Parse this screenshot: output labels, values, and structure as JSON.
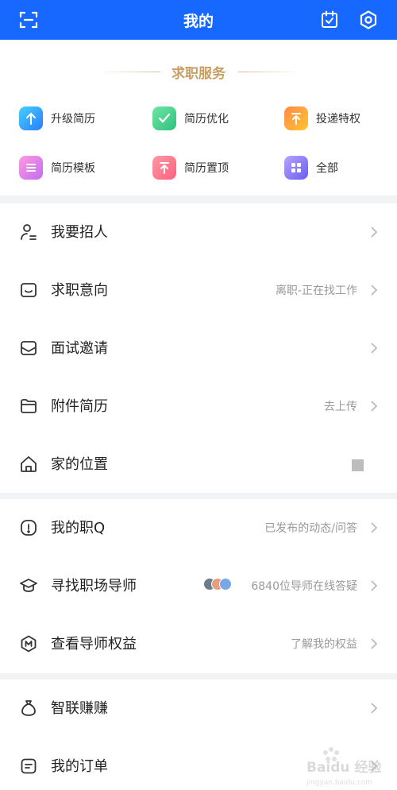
{
  "header": {
    "title": "我的",
    "icons": [
      "scan-icon",
      "calendar-check-icon",
      "settings-icon"
    ],
    "bg_color": "#1768ff"
  },
  "services": {
    "title": "求职服务",
    "items": [
      {
        "label": "升级简历",
        "icon": "upgrade-resume-icon",
        "color": "#39a7ff"
      },
      {
        "label": "简历优化",
        "icon": "resume-optimize-icon",
        "color": "#3bd28a"
      },
      {
        "label": "投递特权",
        "icon": "delivery-privilege-icon",
        "color": "#ffb020"
      },
      {
        "label": "简历模板",
        "icon": "resume-template-icon",
        "color": "#f27ad6"
      },
      {
        "label": "简历置顶",
        "icon": "resume-top-icon",
        "color": "#ff6f8a"
      },
      {
        "label": "全部",
        "icon": "all-services-icon",
        "color": "#7b6cf6"
      }
    ]
  },
  "menu_group_1": [
    {
      "label": "我要招人",
      "sub": "",
      "icon": "recruit-person-icon"
    },
    {
      "label": "求职意向",
      "sub": "离职-正在找工作",
      "icon": "job-intention-icon"
    },
    {
      "label": "面试邀请",
      "sub": "",
      "icon": "interview-mail-icon"
    },
    {
      "label": "附件简历",
      "sub": "去上传",
      "icon": "folder-icon"
    },
    {
      "label": "家的位置",
      "sub": "",
      "icon": "home-icon"
    }
  ],
  "menu_group_2": [
    {
      "label": "我的职Q",
      "sub": "已发布的动态/问答",
      "icon": "info-circle-icon"
    },
    {
      "label": "寻找职场导师",
      "sub": "6840位导师在线答疑",
      "icon": "graduation-cap-icon"
    },
    {
      "label": "查看导师权益",
      "sub": "了解我的权益",
      "icon": "m-badge-icon"
    }
  ],
  "menu_group_3": [
    {
      "label": "智联赚赚",
      "sub": "",
      "icon": "money-bag-icon"
    },
    {
      "label": "我的订单",
      "sub": "",
      "icon": "order-list-icon"
    }
  ],
  "watermark": "Baidu 经验",
  "watermark_sub": "jingyan.baidu.com"
}
